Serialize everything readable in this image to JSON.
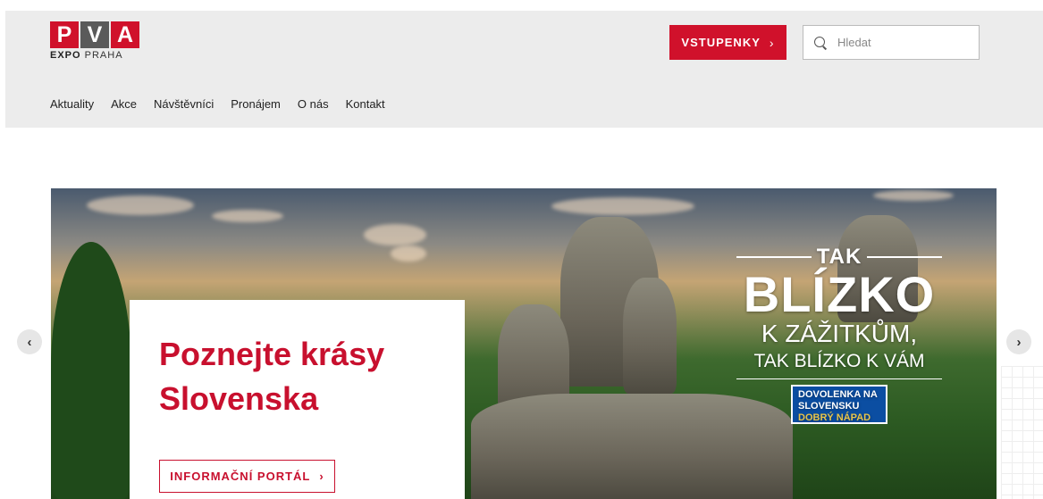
{
  "logo": {
    "letters": [
      "P",
      "V",
      "A"
    ],
    "sub_bold": "EXPO",
    "sub_rest": " PRAHA"
  },
  "header": {
    "tickets_label": "VSTUPENKY",
    "search_placeholder": "Hledat"
  },
  "nav": {
    "items": [
      {
        "label": "Aktuality"
      },
      {
        "label": "Akce"
      },
      {
        "label": "Návštěvníci"
      },
      {
        "label": "Pronájem"
      },
      {
        "label": "O nás"
      },
      {
        "label": "Kontakt"
      }
    ]
  },
  "hero": {
    "title_line1": "Poznejte krásy",
    "title_line2": "Slovenska",
    "button_label": "INFORMAČNÍ PORTÁL",
    "slogan": {
      "line1": "TAK",
      "line2": "BLÍZKO",
      "line3": "K ZÁŽITKŮM,",
      "line4": "TAK BLÍZKO K VÁM",
      "badge_line1": "DOVOLENKA NA",
      "badge_line2": "SLOVENSKU",
      "badge_line3": "DOBRÝ NÁPAD"
    }
  },
  "icons": {
    "chevron": "›",
    "prev": "‹",
    "next": "›"
  },
  "colors": {
    "brand_red": "#d0112b",
    "badge_blue": "#0b4ea2"
  }
}
